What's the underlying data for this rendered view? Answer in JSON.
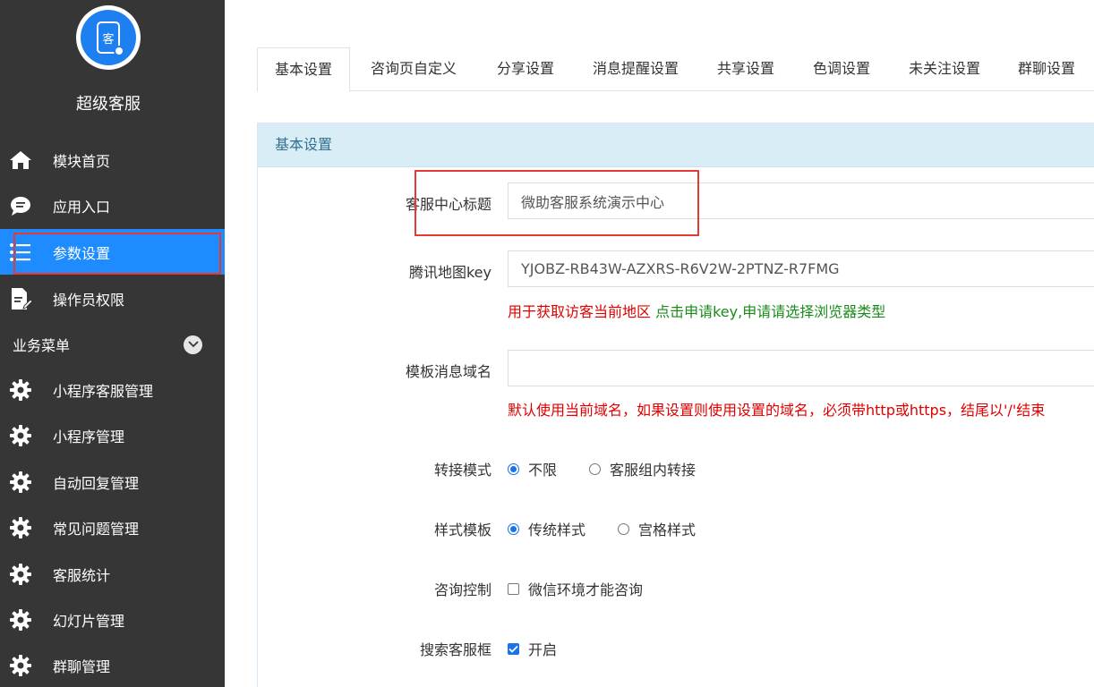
{
  "sidebar": {
    "logo_char": "客",
    "app_title": "超级客服",
    "items": [
      {
        "label": "模块首页",
        "icon": "home-icon"
      },
      {
        "label": "应用入口",
        "icon": "chat-bubble-icon"
      },
      {
        "label": "参数设置",
        "icon": "list-icon"
      },
      {
        "label": "操作员权限",
        "icon": "document-edit-icon"
      }
    ],
    "section_label": "业务菜单",
    "business_items": [
      {
        "label": "小程序客服管理",
        "icon": "gear-icon"
      },
      {
        "label": "小程序管理",
        "icon": "gear-icon"
      },
      {
        "label": "自动回复管理",
        "icon": "gear-icon"
      },
      {
        "label": "常见问题管理",
        "icon": "gear-icon"
      },
      {
        "label": "客服统计",
        "icon": "gear-icon"
      },
      {
        "label": "幻灯片管理",
        "icon": "gear-icon"
      },
      {
        "label": "群聊管理",
        "icon": "gear-icon"
      }
    ],
    "active_color": "#1e8cff",
    "bg_color": "#363636"
  },
  "tabs": [
    {
      "label": "基本设置"
    },
    {
      "label": "咨询页自定义"
    },
    {
      "label": "分享设置"
    },
    {
      "label": "消息提醒设置"
    },
    {
      "label": "共享设置"
    },
    {
      "label": "色调设置"
    },
    {
      "label": "未关注设置"
    },
    {
      "label": "群聊设置"
    }
  ],
  "panel": {
    "title": "基本设置",
    "fields": {
      "center_title": {
        "label": "客服中心标题",
        "value": "微助客服系统演示中心"
      },
      "map_key": {
        "label": "腾讯地图key",
        "value": "YJOBZ-RB43W-AZXRS-R6V2W-2PTNZ-R7FMG",
        "hint_red": "用于获取访客当前地区",
        "hint_green": "点击申请key,申请请选择浏览器类型"
      },
      "template_domain": {
        "label": "模板消息域名",
        "value": "",
        "hint": "默认使用当前域名，如果设置则使用设置的域名，必须带http或https，结尾以'/'结束"
      },
      "transfer_mode": {
        "label": "转接模式",
        "options": [
          "不限",
          "客服组内转接"
        ],
        "selected": 0
      },
      "style_template": {
        "label": "样式模板",
        "options": [
          "传统样式",
          "宫格样式"
        ],
        "selected": 0
      },
      "consult_control": {
        "label": "咨询控制",
        "option": "微信环境才能咨询",
        "checked": false
      },
      "search_box": {
        "label": "搜索客服框",
        "option": "开启",
        "checked": true
      }
    }
  }
}
